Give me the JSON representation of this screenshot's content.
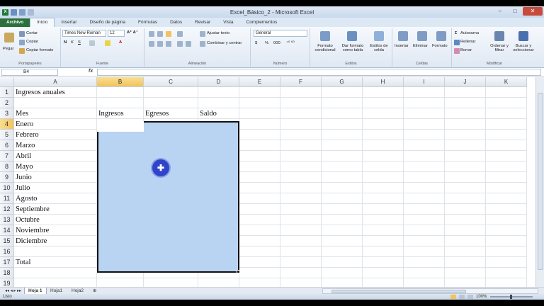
{
  "window": {
    "title": "Excel_Básico_2 - Microsoft Excel"
  },
  "ribbon_tabs": [
    "Archivo",
    "Inicio",
    "Insertar",
    "Diseño de página",
    "Fórmulas",
    "Datos",
    "Revisar",
    "Vista",
    "Complementos"
  ],
  "ribbon": {
    "clipboard": {
      "paste": "Pegar",
      "cut": "Cortar",
      "copy": "Copiar",
      "format_painter": "Copiar formato",
      "label": "Portapapeles"
    },
    "font": {
      "name": "Times New Roman",
      "size": "12",
      "label": "Fuente"
    },
    "alignment": {
      "wrap": "Ajustar texto",
      "merge": "Combinar y centrar",
      "label": "Alineación"
    },
    "number": {
      "format": "General",
      "percent": "%",
      "thousands": "000",
      "currency": "$",
      "label": "Número"
    },
    "styles": {
      "conditional": "Formato condicional",
      "as_table": "Dar formato como tabla",
      "cell_styles": "Estilos de celda",
      "label": "Estilos"
    },
    "cells": {
      "insert": "Insertar",
      "delete": "Eliminar",
      "format": "Formato",
      "label": "Celdas"
    },
    "editing": {
      "autosum": "Autosuma",
      "fill": "Rellenar",
      "clear": "Borrar",
      "sort": "Ordenar y filtrar",
      "find": "Buscar y seleccionar",
      "label": "Modificar"
    }
  },
  "formula_bar": {
    "name_box": "B4",
    "fx": "fx",
    "value": ""
  },
  "columns": [
    "A",
    "B",
    "C",
    "D",
    "E",
    "F",
    "G",
    "H",
    "I",
    "J",
    "K"
  ],
  "rows": [
    "1",
    "2",
    "3",
    "4",
    "5",
    "6",
    "7",
    "8",
    "9",
    "10",
    "11",
    "12",
    "13",
    "14",
    "15",
    "16",
    "17",
    "18",
    "19"
  ],
  "cells": {
    "A1": "Ingresos anuales",
    "A3": "Mes",
    "B3": "Ingresos",
    "C3": "Egresos",
    "D3": "Saldo",
    "A4": "Enero",
    "A5": "Febrero",
    "A6": "Marzo",
    "A7": "Abril",
    "A8": "Mayo",
    "A9": "Junio",
    "A10": "Julio",
    "A11": "Agosto",
    "A12": "Septiembre",
    "A13": "Octubre",
    "A14": "Noviembre",
    "A15": "Diciembre",
    "A17": "Total"
  },
  "sheets": [
    "Hoja 1",
    "Hoja1",
    "Hoja2"
  ],
  "status": {
    "mode": "Listo",
    "zoom": "100%"
  }
}
